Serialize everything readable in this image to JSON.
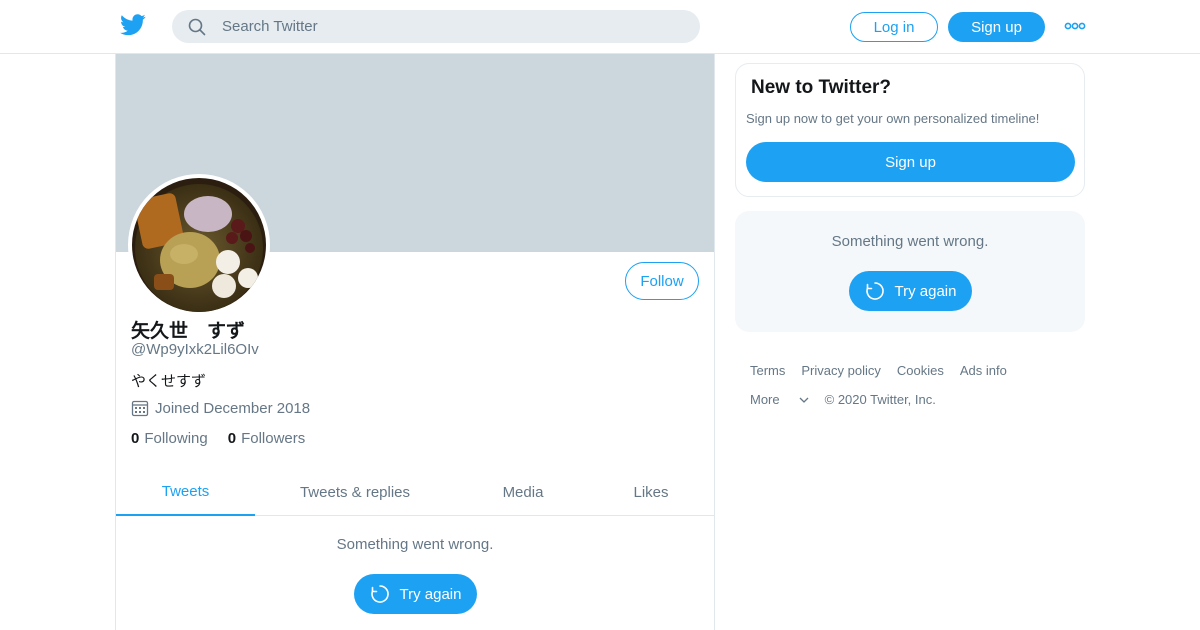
{
  "header": {
    "search_placeholder": "Search Twitter",
    "login_label": "Log in",
    "signup_label": "Sign up",
    "brand_color": "#1da1f2"
  },
  "profile": {
    "display_name": "矢久世　すず",
    "handle": "@Wp9yIxk2Lil6OIv",
    "bio": "やくせすず",
    "joined": "Joined December 2018",
    "follow_label": "Follow",
    "following_count": "0",
    "following_label": "Following",
    "followers_count": "0",
    "followers_label": "Followers"
  },
  "tabs": [
    {
      "label": "Tweets",
      "active": true
    },
    {
      "label": "Tweets & replies",
      "active": false
    },
    {
      "label": "Media",
      "active": false
    },
    {
      "label": "Likes",
      "active": false
    }
  ],
  "timeline": {
    "error_text": "Something went wrong.",
    "retry_label": "Try again"
  },
  "sidebar": {
    "new_title": "New to Twitter?",
    "new_desc": "Sign up now to get your own personalized timeline!",
    "signup_label": "Sign up",
    "error_text": "Something went wrong.",
    "retry_label": "Try again"
  },
  "footer": {
    "links": [
      "Terms",
      "Privacy policy",
      "Cookies",
      "Ads info"
    ],
    "more_label": "More",
    "copyright": "© 2020 Twitter, Inc."
  }
}
